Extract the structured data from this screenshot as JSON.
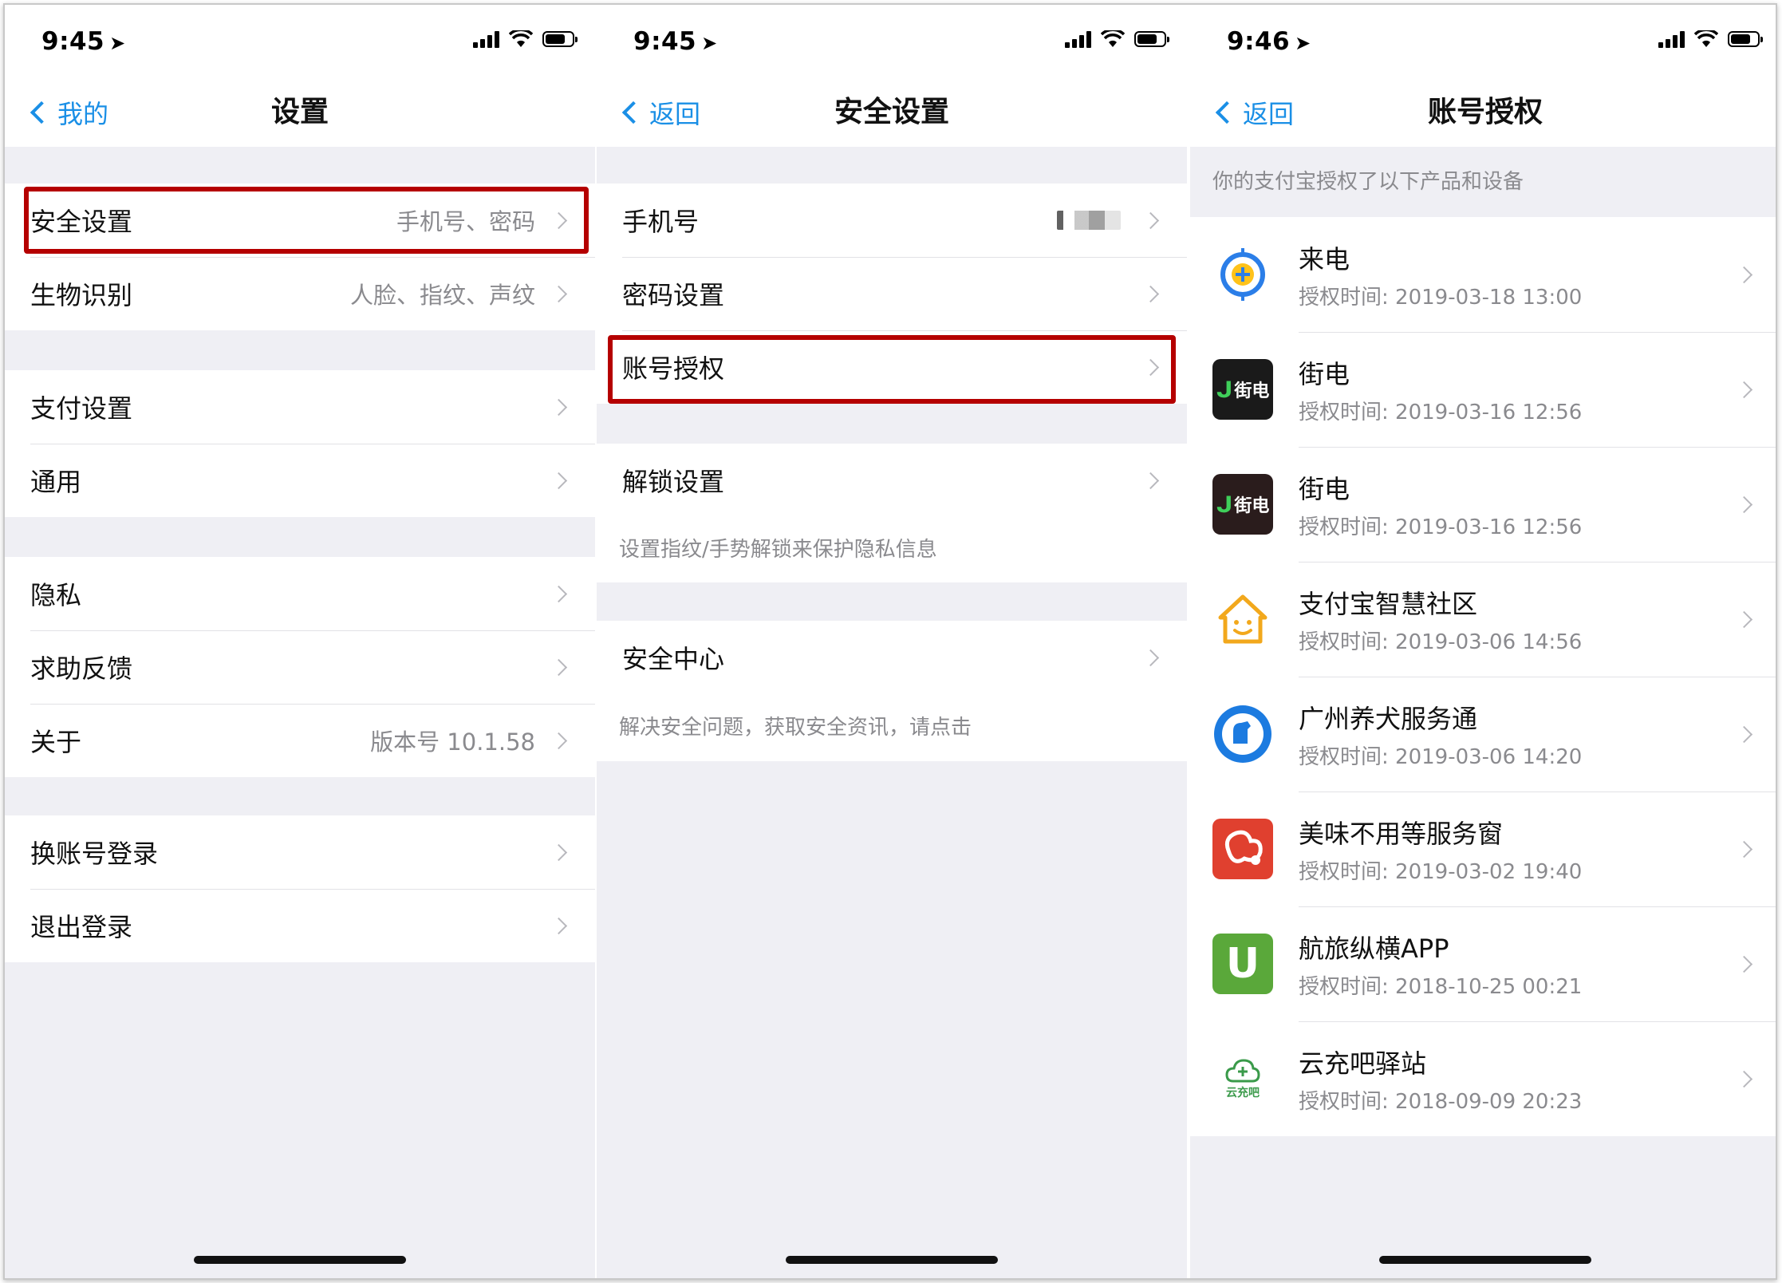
{
  "screens": [
    {
      "time": "9:45",
      "back_label": "我的",
      "title": "设置",
      "groups": [
        [
          {
            "label": "安全设置",
            "value": "手机号、密码"
          },
          {
            "label": "生物识别",
            "value": "人脸、指纹、声纹"
          }
        ],
        [
          {
            "label": "支付设置",
            "value": ""
          },
          {
            "label": "通用",
            "value": ""
          }
        ],
        [
          {
            "label": "隐私",
            "value": ""
          },
          {
            "label": "求助反馈",
            "value": ""
          },
          {
            "label": "关于",
            "value": "版本号 10.1.58"
          }
        ],
        [
          {
            "label": "换账号登录",
            "value": ""
          },
          {
            "label": "退出登录",
            "value": ""
          }
        ]
      ]
    },
    {
      "time": "9:45",
      "back_label": "返回",
      "title": "安全设置",
      "items": [
        {
          "label": "手机号"
        },
        {
          "label": "密码设置"
        },
        {
          "label": "账号授权"
        },
        {
          "label": "解锁设置"
        },
        {
          "label": "安全中心"
        }
      ],
      "hints": [
        "设置指纹/手势解锁来保护隐私信息",
        "解决安全问题，获取安全资讯，请点击"
      ]
    },
    {
      "time": "9:46",
      "back_label": "返回",
      "title": "账号授权",
      "header": "你的支付宝授权了以下产品和设备",
      "apps": [
        {
          "name": "来电",
          "time": "授权时间: 2019-03-18 13:00",
          "icon": "laidian-icon"
        },
        {
          "name": "街电",
          "time": "授权时间: 2019-03-16 12:56",
          "icon": "jiedian-icon",
          "logo_text": "街电"
        },
        {
          "name": "街电",
          "time": "授权时间: 2019-03-16 12:56",
          "icon": "jiedian-icon",
          "logo_text": "街电"
        },
        {
          "name": "支付宝智慧社区",
          "time": "授权时间: 2019-03-06 14:56",
          "icon": "house-smile-icon"
        },
        {
          "name": "广州养犬服务通",
          "time": "授权时间: 2019-03-06 14:20",
          "icon": "dog-badge-icon"
        },
        {
          "name": "美味不用等服务窗",
          "time": "授权时间: 2019-03-02 19:40",
          "icon": "meiwei-icon"
        },
        {
          "name": "航旅纵横APP",
          "time": "授权时间: 2018-10-25 00:21",
          "icon": "hanglv-icon",
          "logo_text": "U"
        },
        {
          "name": "云充吧驿站",
          "time": "授权时间: 2018-09-09 20:23",
          "icon": "yunchong-icon",
          "logo_text": "云充吧"
        }
      ]
    }
  ],
  "colors": {
    "accent": "#1a8fe6",
    "highlight": "#b50000",
    "background": "#efeff4",
    "secondary_text": "#8a8a8e"
  }
}
